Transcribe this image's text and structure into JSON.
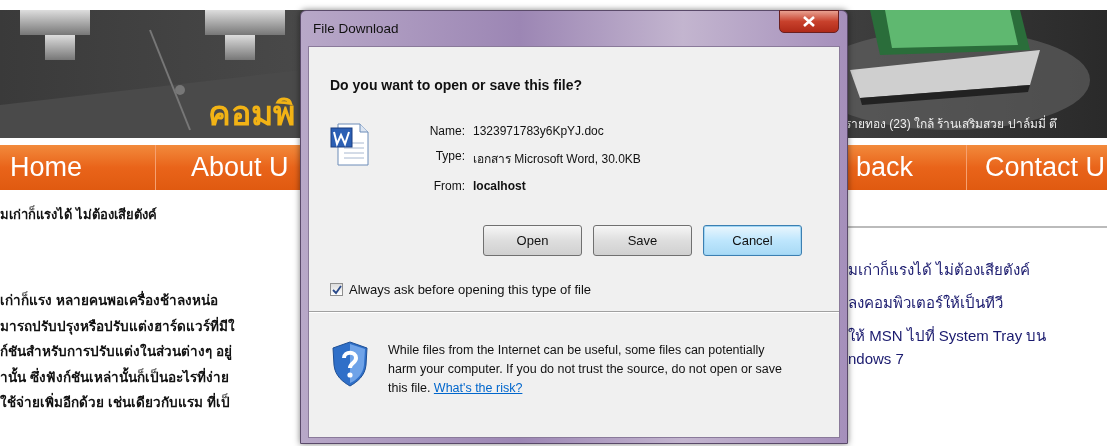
{
  "website": {
    "logo": "คอมพิ",
    "address": "รายทอง (23) ใกล้ ร้านเสริมสวย ปาล์มมี่ ตึ",
    "nav": [
      {
        "label": "Home"
      },
      {
        "label": "About U"
      },
      {
        "label": "back"
      },
      {
        "label": "Contact U"
      }
    ],
    "article": {
      "title": "มเก่าก็แรงได้ ไม่ต้องเสียตังค์",
      "lines": [
        "เก่าก็แรง   หลายคนพอเครื่องช้าลงหน่อ",
        "มารถปรับปรุงหรือปรับแต่งฮาร์ดแวร์ที่มีใ",
        "ก์ชันสำหรับการปรับแต่งในส่วนต่างๆ อยู่",
        "านั้น ซึ่งฟังก์ชันเหล่านั้นก็เป็นอะไรที่ง่าย",
        "ใช้จ่ายเพิ่มอีกด้วย เช่นเดียวกับแรม ที่เป็"
      ]
    },
    "sidebar_links": [
      {
        "lines": [
          "มเก่าก็แรงได้ ไม่ต้องเสียตังค์"
        ]
      },
      {
        "lines": [
          "ลงคอมพิวเตอร์ให้เป็นทีวี"
        ]
      },
      {
        "lines": [
          "ให้ MSN ไปที่ System Tray บน",
          "ndows 7"
        ]
      }
    ]
  },
  "dialog": {
    "title": "File Download",
    "question": "Do you want to open or save this file?",
    "details": [
      {
        "label": "Name:",
        "value": "1323971783y6KpYJ.doc",
        "bold": false
      },
      {
        "label": "Type:",
        "value": "เอกสาร Microsoft Word, 30.0KB",
        "bold": false
      },
      {
        "label": "From:",
        "value": "localhost",
        "bold": true
      }
    ],
    "buttons": [
      {
        "label": "Open",
        "focused": false
      },
      {
        "label": "Save",
        "focused": false
      },
      {
        "label": "Cancel",
        "focused": true
      }
    ],
    "checkbox": {
      "label": "Always ask before opening this type of file",
      "checked": true
    },
    "warning": {
      "text": "While files from the Internet can be useful, some files can potentially harm your computer. If you do not trust the source, do not open or save this file.",
      "link": "What's the risk?"
    }
  }
}
